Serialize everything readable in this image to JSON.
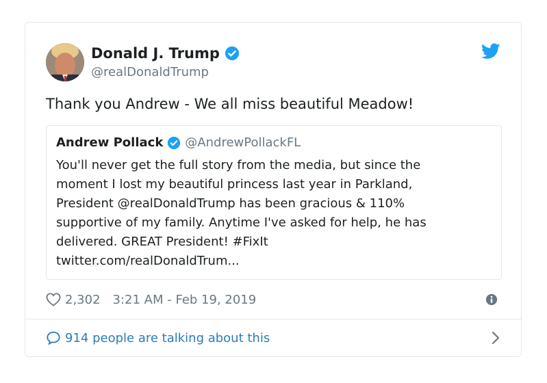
{
  "author": {
    "name": "Donald J. Trump",
    "handle": "@realDonaldTrump"
  },
  "tweet": {
    "text": "Thank you Andrew - We all miss beautiful Meadow!"
  },
  "quoted": {
    "name": "Andrew Pollack",
    "handle": "@AndrewPollackFL",
    "lines": [
      "You'll never get the full story from the media, but since the",
      "moment I lost my beautiful princess last year in Parkland,",
      "President @realDonaldTrump has been gracious & 110%",
      "supportive of my family. Anytime I've asked for help, he has",
      "delivered. GREAT President! #FixIt",
      "twitter.com/realDonaldTrum..."
    ]
  },
  "meta": {
    "likes": "2,302",
    "timestamp": "3:21 AM - Feb 19, 2019"
  },
  "footer": {
    "talking": "914 people are talking about this"
  },
  "icons": {
    "verified": "verified-badge-icon",
    "twitter": "twitter-bird-icon",
    "like": "heart-icon",
    "info": "info-icon",
    "reply": "speech-bubble-icon",
    "more": "chevron-right-icon"
  },
  "colors": {
    "twitter_blue": "#1da1f2",
    "link_blue": "#2b7bb9",
    "secondary_text": "#697882",
    "border": "#e1e8ed"
  }
}
